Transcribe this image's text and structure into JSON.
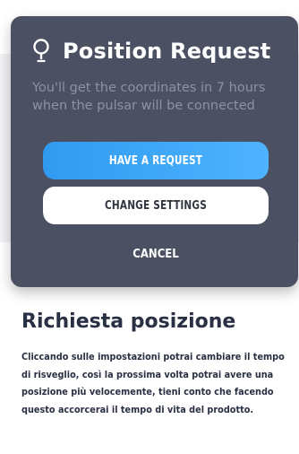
{
  "modal": {
    "title": "Position Request",
    "icon": "lightbulb-pin-icon",
    "subtitle": "You'll get the coordinates in 7 hours when the pulsar will be connected",
    "primary_button": "HAVE A REQUEST",
    "secondary_button": "CHANGE SETTINGS",
    "cancel_button": "CANCEL"
  },
  "section": {
    "title": "Richiesta posizione",
    "body": "Cliccando sulle impostazioni potrai cambiare il tempo di risveglio, così la prossima volta potrai avere una posizione più velocemente, tieni conto che facendo questo accorcerai il tempo di vita del prodotto."
  },
  "colors": {
    "modal_bg": "#4b5163",
    "accent": "#2f9bf0",
    "text_dark": "#2a3043",
    "subtitle": "#8c92a2"
  }
}
